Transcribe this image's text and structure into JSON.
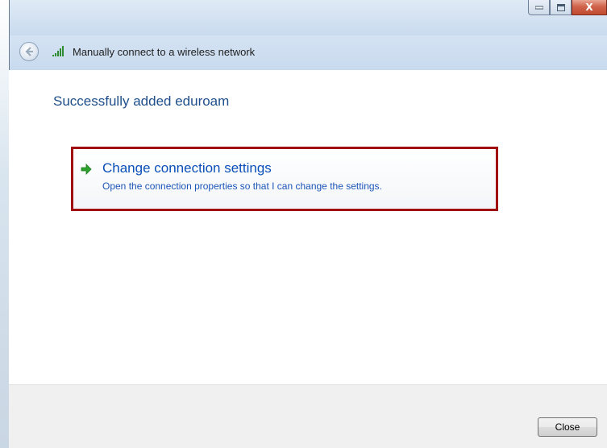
{
  "window": {
    "title": "Manually connect to a wireless network",
    "controls": {
      "minimize_icon": "minimize-icon",
      "maximize_icon": "maximize-icon",
      "close_icon": "close-icon",
      "close_label": "X"
    }
  },
  "nav": {
    "back_icon": "back-arrow-icon",
    "network_icon": "wireless-signal-icon"
  },
  "main": {
    "heading": "Successfully added eduroam",
    "command_link": {
      "icon": "green-arrow-icon",
      "title": "Change connection settings",
      "description": "Open the connection properties so that I can change the settings."
    }
  },
  "footer": {
    "close_label": "Close"
  },
  "colors": {
    "heading": "#1e4f8a",
    "link": "#0a4fb8",
    "highlight_border": "#a01010",
    "close_button_red": "#c04a2f"
  }
}
